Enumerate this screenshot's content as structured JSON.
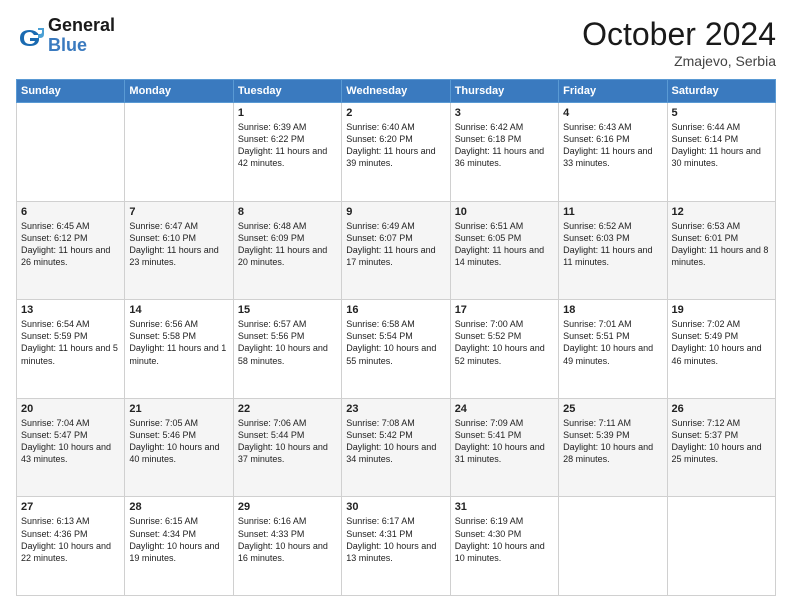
{
  "header": {
    "logo_general": "General",
    "logo_blue": "Blue",
    "month": "October 2024",
    "location": "Zmajevo, Serbia"
  },
  "days_of_week": [
    "Sunday",
    "Monday",
    "Tuesday",
    "Wednesday",
    "Thursday",
    "Friday",
    "Saturday"
  ],
  "weeks": [
    [
      {
        "day": "",
        "sunrise": "",
        "sunset": "",
        "daylight": ""
      },
      {
        "day": "",
        "sunrise": "",
        "sunset": "",
        "daylight": ""
      },
      {
        "day": "1",
        "sunrise": "Sunrise: 6:39 AM",
        "sunset": "Sunset: 6:22 PM",
        "daylight": "Daylight: 11 hours and 42 minutes."
      },
      {
        "day": "2",
        "sunrise": "Sunrise: 6:40 AM",
        "sunset": "Sunset: 6:20 PM",
        "daylight": "Daylight: 11 hours and 39 minutes."
      },
      {
        "day": "3",
        "sunrise": "Sunrise: 6:42 AM",
        "sunset": "Sunset: 6:18 PM",
        "daylight": "Daylight: 11 hours and 36 minutes."
      },
      {
        "day": "4",
        "sunrise": "Sunrise: 6:43 AM",
        "sunset": "Sunset: 6:16 PM",
        "daylight": "Daylight: 11 hours and 33 minutes."
      },
      {
        "day": "5",
        "sunrise": "Sunrise: 6:44 AM",
        "sunset": "Sunset: 6:14 PM",
        "daylight": "Daylight: 11 hours and 30 minutes."
      }
    ],
    [
      {
        "day": "6",
        "sunrise": "Sunrise: 6:45 AM",
        "sunset": "Sunset: 6:12 PM",
        "daylight": "Daylight: 11 hours and 26 minutes."
      },
      {
        "day": "7",
        "sunrise": "Sunrise: 6:47 AM",
        "sunset": "Sunset: 6:10 PM",
        "daylight": "Daylight: 11 hours and 23 minutes."
      },
      {
        "day": "8",
        "sunrise": "Sunrise: 6:48 AM",
        "sunset": "Sunset: 6:09 PM",
        "daylight": "Daylight: 11 hours and 20 minutes."
      },
      {
        "day": "9",
        "sunrise": "Sunrise: 6:49 AM",
        "sunset": "Sunset: 6:07 PM",
        "daylight": "Daylight: 11 hours and 17 minutes."
      },
      {
        "day": "10",
        "sunrise": "Sunrise: 6:51 AM",
        "sunset": "Sunset: 6:05 PM",
        "daylight": "Daylight: 11 hours and 14 minutes."
      },
      {
        "day": "11",
        "sunrise": "Sunrise: 6:52 AM",
        "sunset": "Sunset: 6:03 PM",
        "daylight": "Daylight: 11 hours and 11 minutes."
      },
      {
        "day": "12",
        "sunrise": "Sunrise: 6:53 AM",
        "sunset": "Sunset: 6:01 PM",
        "daylight": "Daylight: 11 hours and 8 minutes."
      }
    ],
    [
      {
        "day": "13",
        "sunrise": "Sunrise: 6:54 AM",
        "sunset": "Sunset: 5:59 PM",
        "daylight": "Daylight: 11 hours and 5 minutes."
      },
      {
        "day": "14",
        "sunrise": "Sunrise: 6:56 AM",
        "sunset": "Sunset: 5:58 PM",
        "daylight": "Daylight: 11 hours and 1 minute."
      },
      {
        "day": "15",
        "sunrise": "Sunrise: 6:57 AM",
        "sunset": "Sunset: 5:56 PM",
        "daylight": "Daylight: 10 hours and 58 minutes."
      },
      {
        "day": "16",
        "sunrise": "Sunrise: 6:58 AM",
        "sunset": "Sunset: 5:54 PM",
        "daylight": "Daylight: 10 hours and 55 minutes."
      },
      {
        "day": "17",
        "sunrise": "Sunrise: 7:00 AM",
        "sunset": "Sunset: 5:52 PM",
        "daylight": "Daylight: 10 hours and 52 minutes."
      },
      {
        "day": "18",
        "sunrise": "Sunrise: 7:01 AM",
        "sunset": "Sunset: 5:51 PM",
        "daylight": "Daylight: 10 hours and 49 minutes."
      },
      {
        "day": "19",
        "sunrise": "Sunrise: 7:02 AM",
        "sunset": "Sunset: 5:49 PM",
        "daylight": "Daylight: 10 hours and 46 minutes."
      }
    ],
    [
      {
        "day": "20",
        "sunrise": "Sunrise: 7:04 AM",
        "sunset": "Sunset: 5:47 PM",
        "daylight": "Daylight: 10 hours and 43 minutes."
      },
      {
        "day": "21",
        "sunrise": "Sunrise: 7:05 AM",
        "sunset": "Sunset: 5:46 PM",
        "daylight": "Daylight: 10 hours and 40 minutes."
      },
      {
        "day": "22",
        "sunrise": "Sunrise: 7:06 AM",
        "sunset": "Sunset: 5:44 PM",
        "daylight": "Daylight: 10 hours and 37 minutes."
      },
      {
        "day": "23",
        "sunrise": "Sunrise: 7:08 AM",
        "sunset": "Sunset: 5:42 PM",
        "daylight": "Daylight: 10 hours and 34 minutes."
      },
      {
        "day": "24",
        "sunrise": "Sunrise: 7:09 AM",
        "sunset": "Sunset: 5:41 PM",
        "daylight": "Daylight: 10 hours and 31 minutes."
      },
      {
        "day": "25",
        "sunrise": "Sunrise: 7:11 AM",
        "sunset": "Sunset: 5:39 PM",
        "daylight": "Daylight: 10 hours and 28 minutes."
      },
      {
        "day": "26",
        "sunrise": "Sunrise: 7:12 AM",
        "sunset": "Sunset: 5:37 PM",
        "daylight": "Daylight: 10 hours and 25 minutes."
      }
    ],
    [
      {
        "day": "27",
        "sunrise": "Sunrise: 6:13 AM",
        "sunset": "Sunset: 4:36 PM",
        "daylight": "Daylight: 10 hours and 22 minutes."
      },
      {
        "day": "28",
        "sunrise": "Sunrise: 6:15 AM",
        "sunset": "Sunset: 4:34 PM",
        "daylight": "Daylight: 10 hours and 19 minutes."
      },
      {
        "day": "29",
        "sunrise": "Sunrise: 6:16 AM",
        "sunset": "Sunset: 4:33 PM",
        "daylight": "Daylight: 10 hours and 16 minutes."
      },
      {
        "day": "30",
        "sunrise": "Sunrise: 6:17 AM",
        "sunset": "Sunset: 4:31 PM",
        "daylight": "Daylight: 10 hours and 13 minutes."
      },
      {
        "day": "31",
        "sunrise": "Sunrise: 6:19 AM",
        "sunset": "Sunset: 4:30 PM",
        "daylight": "Daylight: 10 hours and 10 minutes."
      },
      {
        "day": "",
        "sunrise": "",
        "sunset": "",
        "daylight": ""
      },
      {
        "day": "",
        "sunrise": "",
        "sunset": "",
        "daylight": ""
      }
    ]
  ]
}
